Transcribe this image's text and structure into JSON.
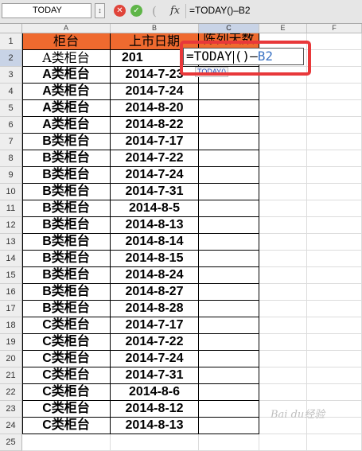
{
  "formula_bar": {
    "name_box": "TODAY",
    "paren_glyph": "(",
    "fx_label": "fx",
    "formula": "=TODAY()–B2",
    "cancel_glyph": "✕",
    "ok_glyph": "✓",
    "arrow_glyph": "↕"
  },
  "columns": [
    "A",
    "B",
    "C",
    "D",
    "E",
    "F"
  ],
  "row_numbers": [
    "1",
    "2",
    "3",
    "4",
    "5",
    "6",
    "7",
    "8",
    "9",
    "10",
    "11",
    "12",
    "13",
    "14",
    "15",
    "16",
    "17",
    "18",
    "19",
    "20",
    "21",
    "22",
    "23",
    "24",
    "25"
  ],
  "header_row": {
    "a": "柜台",
    "b": "上市日期",
    "c": "陈列天数"
  },
  "rows": [
    {
      "a": "A类柜台",
      "b": "201",
      "style": "serif"
    },
    {
      "a": "A类柜台",
      "b": "2014-7-23",
      "style": "bold"
    },
    {
      "a": "A类柜台",
      "b": "2014-7-24",
      "style": "bold"
    },
    {
      "a": "A类柜台",
      "b": "2014-8-20",
      "style": "bold"
    },
    {
      "a": "A类柜台",
      "b": "2014-8-22",
      "style": "bold"
    },
    {
      "a": "B类柜台",
      "b": "2014-7-17",
      "style": "bold"
    },
    {
      "a": "B类柜台",
      "b": "2014-7-22",
      "style": "bold"
    },
    {
      "a": "B类柜台",
      "b": "2014-7-24",
      "style": "bold"
    },
    {
      "a": "B类柜台",
      "b": "2014-7-31",
      "style": "bold"
    },
    {
      "a": "B类柜台",
      "b": "2014-8-5",
      "style": "bold"
    },
    {
      "a": "B类柜台",
      "b": "2014-8-13",
      "style": "bold"
    },
    {
      "a": "B类柜台",
      "b": "2014-8-14",
      "style": "bold"
    },
    {
      "a": "B类柜台",
      "b": "2014-8-15",
      "style": "bold"
    },
    {
      "a": "B类柜台",
      "b": "2014-8-24",
      "style": "bold"
    },
    {
      "a": "B类柜台",
      "b": "2014-8-27",
      "style": "bold"
    },
    {
      "a": "B类柜台",
      "b": "2014-8-28",
      "style": "bold"
    },
    {
      "a": "C类柜台",
      "b": "2014-7-17",
      "style": "bold"
    },
    {
      "a": "C类柜台",
      "b": "2014-7-22",
      "style": "bold"
    },
    {
      "a": "C类柜台",
      "b": "2014-7-24",
      "style": "bold"
    },
    {
      "a": "C类柜台",
      "b": "2014-7-31",
      "style": "bold"
    },
    {
      "a": "C类柜台",
      "b": "2014-8-6",
      "style": "bold"
    },
    {
      "a": "C类柜台",
      "b": "2014-8-12",
      "style": "bold"
    },
    {
      "a": "C类柜台",
      "b": "2014-8-13",
      "style": "bold"
    }
  ],
  "editor": {
    "prefix": "=TODAY",
    "suffix": "()–",
    "ref": "B2",
    "tooltip": "TODAY()"
  },
  "selection": {
    "active_row": "2",
    "active_column": "C"
  },
  "colors": {
    "header_fill": "#ef6a2f",
    "callout": "#e8383a",
    "ref_blue": "#3b73c4"
  },
  "watermark": "Bai du经验"
}
